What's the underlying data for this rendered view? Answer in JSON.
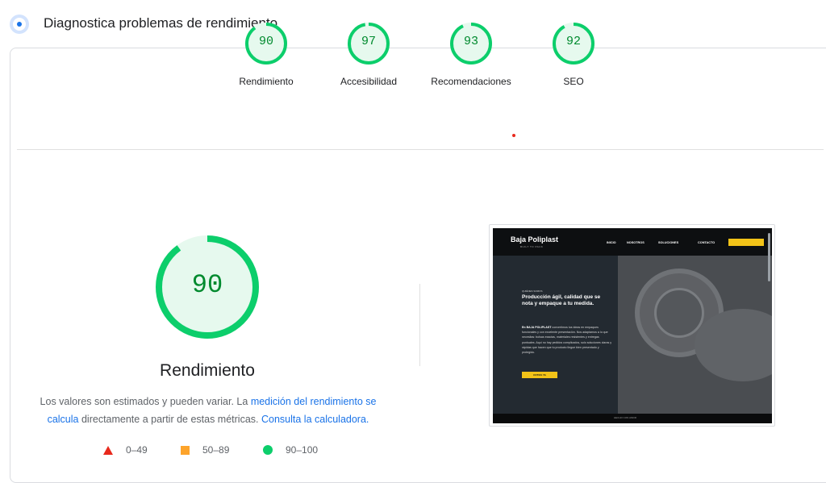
{
  "header": {
    "title": "Diagnostica problemas de rendimiento",
    "icon": "lighthouse-icon"
  },
  "summary": [
    {
      "score": "90",
      "label": "Rendimiento",
      "value": 0.9
    },
    {
      "score": "97",
      "label": "Accesibilidad",
      "value": 0.97
    },
    {
      "score": "93",
      "label": "Recomendaciones",
      "value": 0.93
    },
    {
      "score": "92",
      "label": "SEO",
      "value": 0.92
    }
  ],
  "performance": {
    "score": "90",
    "value": 0.9,
    "label": "Rendimiento",
    "description": {
      "text1": "Los valores son estimados y pueden variar. La ",
      "link1": "medición del rendimiento se calcula",
      "text2": " directamente a partir de estas métricas. ",
      "link2": "Consulta la calculadora."
    }
  },
  "legend": [
    {
      "range": "0–49",
      "shape": "triangle",
      "color": "#e8291c"
    },
    {
      "range": "50–89",
      "shape": "square",
      "color": "#fda42b"
    },
    {
      "range": "90–100",
      "shape": "circle",
      "color": "#0cce6b"
    }
  ],
  "colors": {
    "pass": "#0cce6b",
    "pass_text": "#008a2e",
    "pass_bg": "#e6f9ee",
    "link": "#1a73e8",
    "brand_yellow": "#f2c318"
  },
  "screenshot": {
    "brand": "Baja Poliplast",
    "brand_sub": "BUILT TO PACK",
    "nav": [
      "INICIO",
      "NOSOTROS",
      "SOLUCIONES",
      "CONTACTO"
    ],
    "kicker": "QUIÉNES SOMOS",
    "headline": "Producción ágil, calidad que se nota y empaque a tu medida.",
    "body_lead": "En BAJA POLIPLAST",
    "body": " convertimos tus ideas en empaques funcionales y con excelente presentación. Nos adaptamos a lo que necesitas: bolsas exactas, materiales resistentes y entregas puntuales. Aquí no hay pedidos complicados, solo soluciones claras y rápidas que hacen que tu producto llegue bien presentado y protegido.",
    "cta": "COTIZA YA",
    "footer": "HECHO CON AMOR"
  }
}
